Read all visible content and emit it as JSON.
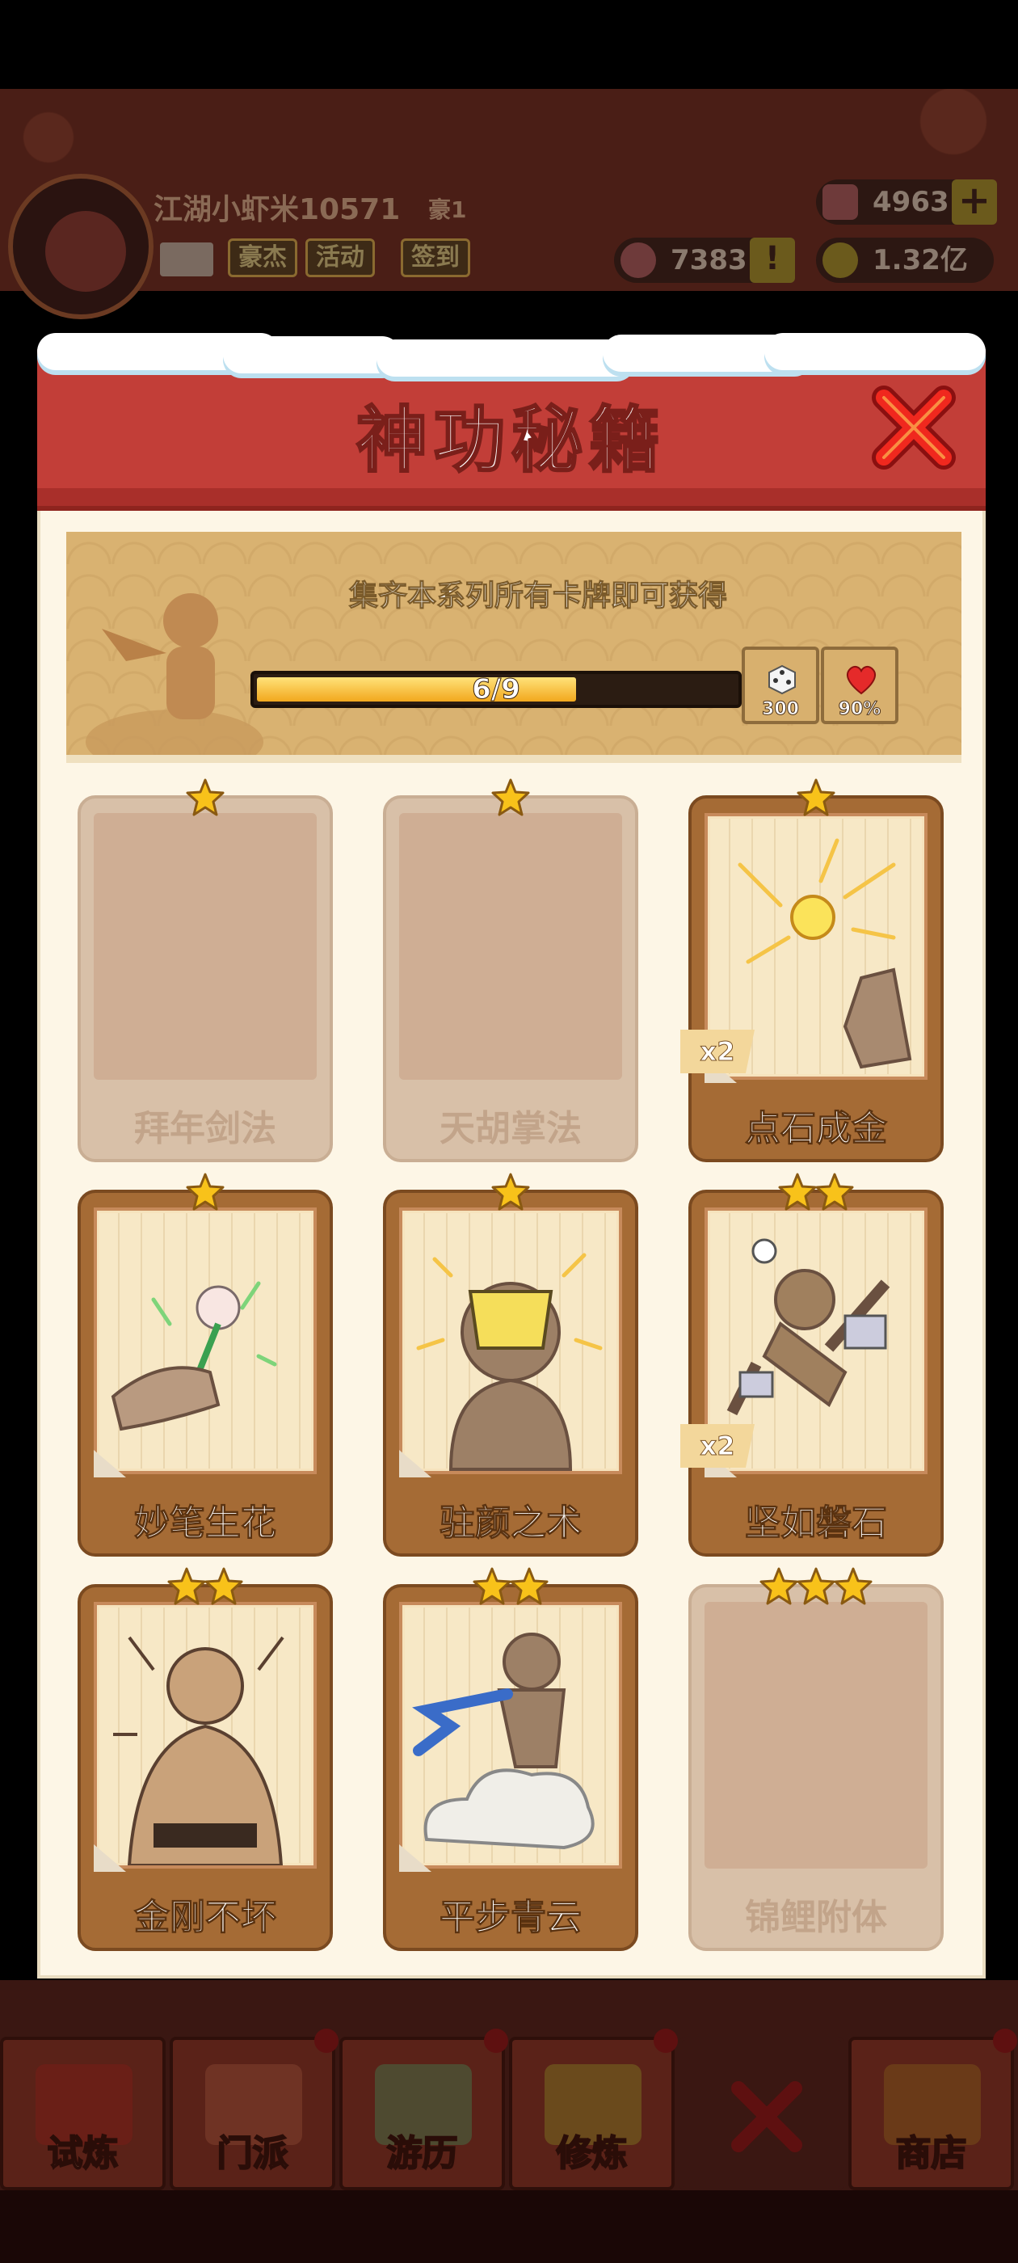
{
  "header": {
    "player_name": "江湖小虾米10571",
    "rank": "豪1",
    "buttons": [
      "豪杰",
      "活动",
      "签到"
    ],
    "resources": {
      "gems": "4963",
      "tokens": "7383",
      "coins": "1.32亿"
    }
  },
  "modal": {
    "title": "神功秘籍",
    "banner_text": "集齐本系列所有卡牌即可获得",
    "progress": {
      "text": "6/9",
      "current": 6,
      "total": 9
    },
    "rewards": [
      {
        "icon": "dice-icon",
        "value": "300"
      },
      {
        "icon": "heart-icon",
        "value": "90%"
      }
    ],
    "cards": [
      {
        "name": "拜年剑法",
        "stars": 1,
        "owned": false,
        "count": ""
      },
      {
        "name": "天胡掌法",
        "stars": 1,
        "owned": false,
        "count": ""
      },
      {
        "name": "点石成金",
        "stars": 1,
        "owned": true,
        "count": "x2"
      },
      {
        "name": "妙笔生花",
        "stars": 1,
        "owned": true,
        "count": ""
      },
      {
        "name": "驻颜之术",
        "stars": 1,
        "owned": true,
        "count": ""
      },
      {
        "name": "坚如磐石",
        "stars": 2,
        "owned": true,
        "count": "x2"
      },
      {
        "name": "金刚不坏",
        "stars": 2,
        "owned": true,
        "count": ""
      },
      {
        "name": "平步青云",
        "stars": 2,
        "owned": true,
        "count": ""
      },
      {
        "name": "锦鲤附体",
        "stars": 3,
        "owned": false,
        "count": ""
      }
    ]
  },
  "tabbar": {
    "tabs": [
      "试炼",
      "门派",
      "游历",
      "修炼",
      "",
      "商店"
    ]
  },
  "colors": {
    "header_red": "#c23e38",
    "card_brown": "#a56b35",
    "star_gold": "#f8c21a",
    "progress_fill": "#f2a81d"
  }
}
